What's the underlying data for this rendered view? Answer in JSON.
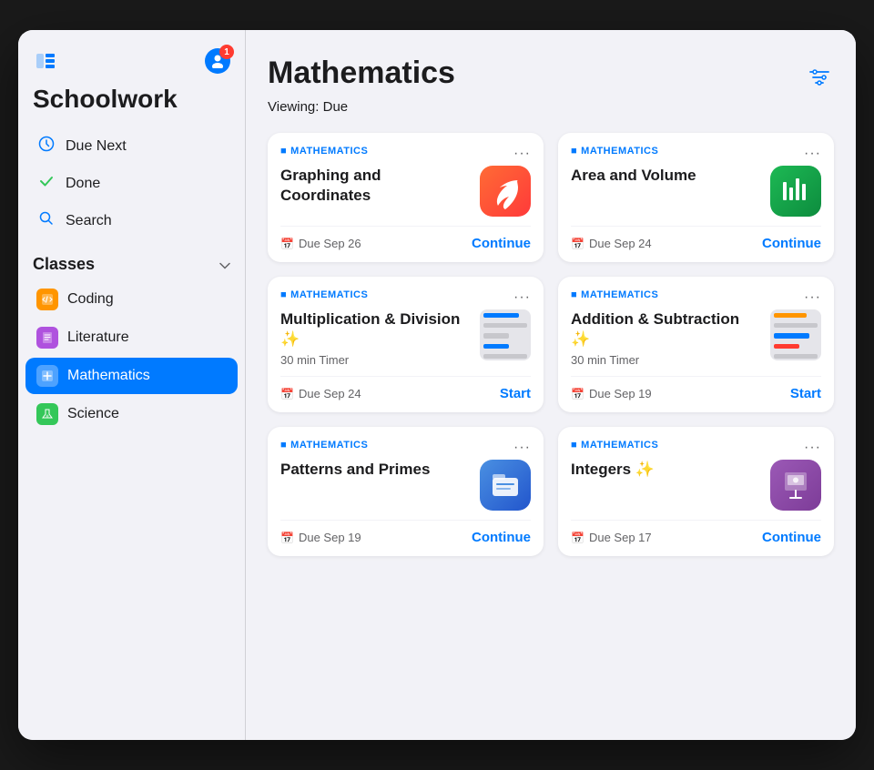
{
  "app": {
    "title": "Schoolwork",
    "window_size": "920x780"
  },
  "sidebar": {
    "toggle_icon": "⊞",
    "user_icon": "👤",
    "notification_count": "1",
    "nav_items": [
      {
        "id": "due-next",
        "label": "Due Next",
        "icon": "⏰",
        "icon_color": "blue"
      },
      {
        "id": "done",
        "label": "Done",
        "icon": "✓",
        "icon_color": "green"
      },
      {
        "id": "search",
        "label": "Search",
        "icon": "🔍",
        "icon_color": "blue"
      }
    ],
    "classes_section": {
      "title": "Classes",
      "chevron": "v",
      "items": [
        {
          "id": "coding",
          "label": "Coding",
          "icon": "📙",
          "color": "orange",
          "active": false
        },
        {
          "id": "literature",
          "label": "Literature",
          "icon": "📊",
          "color": "purple",
          "active": false
        },
        {
          "id": "mathematics",
          "label": "Mathematics",
          "icon": "📋",
          "color": "blue",
          "active": true
        },
        {
          "id": "science",
          "label": "Science",
          "icon": "🌿",
          "color": "green",
          "active": false
        }
      ]
    }
  },
  "main": {
    "page_title": "Mathematics",
    "viewing_prefix": "Viewing:",
    "viewing_value": "Due",
    "filter_icon": "⚙",
    "cards": [
      {
        "id": "graphing-coordinates",
        "label": "MATHEMATICS",
        "title": "Graphing and Coordinates",
        "subtitle": "",
        "app_icon_type": "swift",
        "app_icon_emoji": "🦅",
        "due_date": "Due Sep 26",
        "action": "Continue",
        "has_timer": false
      },
      {
        "id": "area-volume",
        "label": "MATHEMATICS",
        "title": "Area and Volume",
        "subtitle": "",
        "app_icon_type": "numbers",
        "app_icon_emoji": "📊",
        "due_date": "Due Sep 24",
        "action": "Continue",
        "has_timer": false
      },
      {
        "id": "multiplication-division",
        "label": "MATHEMATICS",
        "title": "Multiplication & Division ✨",
        "subtitle": "30 min Timer",
        "app_icon_type": "thumbnail",
        "due_date": "Due Sep 24",
        "action": "Start",
        "has_timer": true
      },
      {
        "id": "addition-subtraction",
        "label": "MATHEMATICS",
        "title": "Addition & Subtraction ✨",
        "subtitle": "30 min Timer",
        "app_icon_type": "thumbnail",
        "due_date": "Due Sep 19",
        "action": "Start",
        "has_timer": true
      },
      {
        "id": "patterns-primes",
        "label": "MATHEMATICS",
        "title": "Patterns and Primes",
        "subtitle": "",
        "app_icon_type": "files",
        "app_icon_emoji": "🗂",
        "due_date": "Due Sep 19",
        "action": "Continue",
        "has_timer": false
      },
      {
        "id": "integers",
        "label": "MATHEMATICS",
        "title": "Integers ✨",
        "subtitle": "",
        "app_icon_type": "keynote",
        "app_icon_emoji": "🎭",
        "due_date": "Due Sep 17",
        "action": "Continue",
        "has_timer": false
      }
    ]
  }
}
